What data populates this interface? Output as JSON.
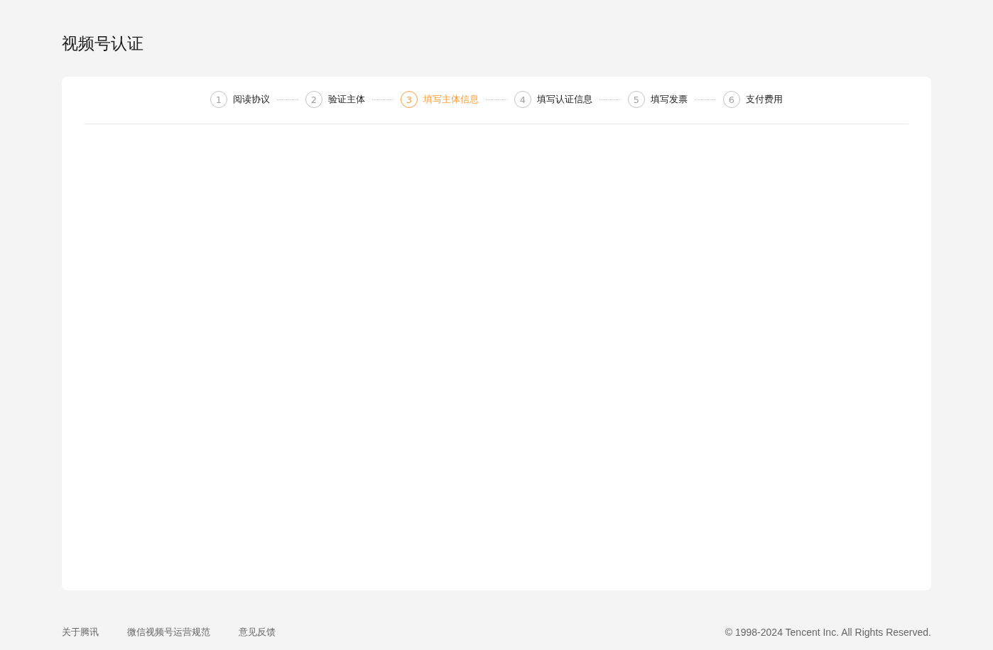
{
  "page_title": "视频号认证",
  "steps": [
    {
      "number": "1",
      "label": "阅读协议",
      "selected": false
    },
    {
      "number": "2",
      "label": "验证主体",
      "selected": false
    },
    {
      "number": "3",
      "label": "填写主体信息",
      "selected": true
    },
    {
      "number": "4",
      "label": "填写认证信息",
      "selected": false
    },
    {
      "number": "5",
      "label": "填写发票",
      "selected": false
    },
    {
      "number": "6",
      "label": "支付费用",
      "selected": false
    }
  ],
  "footer": {
    "links": [
      "关于腾讯",
      "微信视频号运营规范",
      "意见反馈"
    ],
    "copyright": "© 1998-2024 Tencent Inc. All Rights Reserved."
  }
}
